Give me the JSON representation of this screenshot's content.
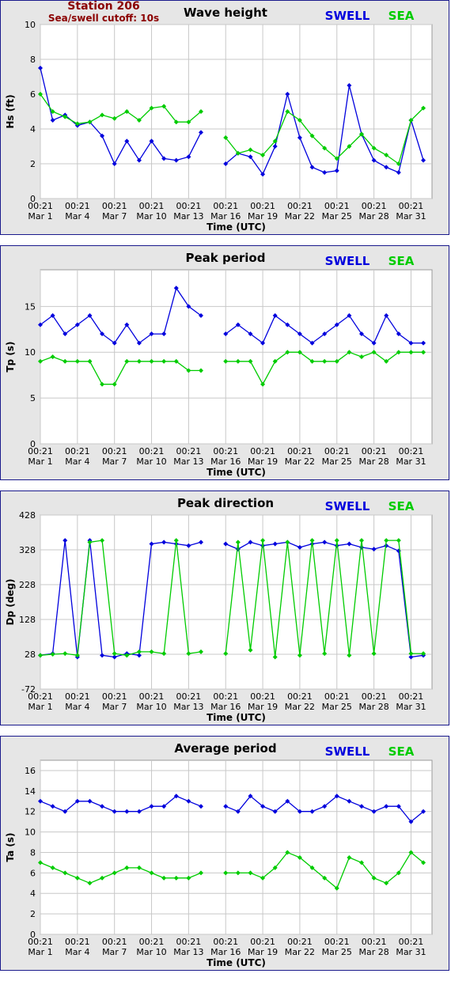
{
  "header": {
    "station_name": "Station 206",
    "cutoff_label": "Sea/swell cutoff: 10s"
  },
  "colors": {
    "swell": "#0000dd",
    "sea": "#00cc00",
    "frame": "#1a1a8c",
    "station_text": "#8b0000"
  },
  "chart_data": [
    {
      "type": "line",
      "title": "Wave height",
      "xlabel": "Time (UTC)",
      "ylabel": "Hs (ft)",
      "ylim": [
        0,
        10
      ],
      "yticks": [
        "0",
        "2",
        "4",
        "6",
        "8",
        "10"
      ],
      "x": [
        1,
        2,
        3,
        4,
        5,
        6,
        7,
        8,
        9,
        10,
        11,
        12,
        13,
        14,
        15,
        16,
        17,
        18,
        19,
        20,
        21,
        22,
        23,
        24,
        25,
        26,
        27,
        28,
        29,
        30,
        31,
        32
      ],
      "x_tick_time": "00:21",
      "x_tick_dates": [
        "Mar 1",
        "Mar 4",
        "Mar 7",
        "Mar 10",
        "Mar 13",
        "Mar 16",
        "Mar 19",
        "Mar 22",
        "Mar 25",
        "Mar 28",
        "Mar 31"
      ],
      "x_tick_positions": [
        1,
        4,
        7,
        10,
        13,
        16,
        19,
        22,
        25,
        28,
        31
      ],
      "xlim": [
        1,
        32.7
      ],
      "grid": true,
      "legend": "top-right",
      "series": [
        {
          "name": "SWELL",
          "values": [
            7.5,
            4.5,
            4.8,
            4.2,
            4.4,
            3.6,
            2.0,
            3.3,
            2.2,
            3.3,
            2.3,
            2.2,
            2.4,
            3.8,
            null,
            2.0,
            2.6,
            2.4,
            1.4,
            3.0,
            6.0,
            3.5,
            1.8,
            1.5,
            1.6,
            6.5,
            3.7,
            2.2,
            1.8,
            1.5,
            4.5,
            2.2
          ]
        },
        {
          "name": "SEA",
          "values": [
            6.0,
            5.0,
            4.7,
            4.3,
            4.4,
            4.8,
            4.6,
            5.0,
            4.5,
            5.2,
            5.3,
            4.4,
            4.4,
            5.0,
            null,
            3.5,
            2.6,
            2.8,
            2.5,
            3.3,
            5.0,
            4.5,
            3.6,
            2.9,
            2.3,
            3.0,
            3.7,
            2.9,
            2.5,
            2.0,
            4.5,
            5.2
          ]
        }
      ]
    },
    {
      "type": "line",
      "title": "Peak period",
      "xlabel": "Time (UTC)",
      "ylabel": "Tp (s)",
      "ylim": [
        0,
        19
      ],
      "yticks": [
        "0",
        "5",
        "10",
        "15"
      ],
      "x": [
        1,
        2,
        3,
        4,
        5,
        6,
        7,
        8,
        9,
        10,
        11,
        12,
        13,
        14,
        15,
        16,
        17,
        18,
        19,
        20,
        21,
        22,
        23,
        24,
        25,
        26,
        27,
        28,
        29,
        30,
        31,
        32
      ],
      "x_tick_time": "00:21",
      "x_tick_dates": [
        "Mar 1",
        "Mar 4",
        "Mar 7",
        "Mar 10",
        "Mar 13",
        "Mar 16",
        "Mar 19",
        "Mar 22",
        "Mar 25",
        "Mar 28",
        "Mar 31"
      ],
      "x_tick_positions": [
        1,
        4,
        7,
        10,
        13,
        16,
        19,
        22,
        25,
        28,
        31
      ],
      "xlim": [
        1,
        32.7
      ],
      "grid": true,
      "legend": "top-right",
      "series": [
        {
          "name": "SWELL",
          "values": [
            13,
            14,
            12,
            13,
            14,
            12,
            11,
            13,
            11,
            12,
            12,
            17,
            15,
            14,
            null,
            12,
            13,
            12,
            11,
            14,
            13,
            12,
            11,
            12,
            13,
            14,
            12,
            11,
            14,
            12,
            11,
            11
          ]
        },
        {
          "name": "SEA",
          "values": [
            9,
            9.5,
            9,
            9,
            9,
            6.5,
            6.5,
            9,
            9,
            9,
            9,
            9,
            8,
            8,
            null,
            9,
            9,
            9,
            6.5,
            9,
            10,
            10,
            9,
            9,
            9,
            10,
            9.5,
            10,
            9,
            10,
            10,
            10
          ]
        }
      ]
    },
    {
      "type": "scatter",
      "title": "Peak direction",
      "xlabel": "Time (UTC)",
      "ylabel": "Dp (deg)",
      "ylim": [
        -72,
        428
      ],
      "yticks": [
        "-72",
        "28",
        "128",
        "228",
        "328",
        "428"
      ],
      "x": [
        1,
        2,
        3,
        4,
        5,
        6,
        7,
        8,
        9,
        10,
        11,
        12,
        13,
        14,
        15,
        16,
        17,
        18,
        19,
        20,
        21,
        22,
        23,
        24,
        25,
        26,
        27,
        28,
        29,
        30,
        31,
        32
      ],
      "x_tick_time": "00:21",
      "x_tick_dates": [
        "Mar 1",
        "Mar 4",
        "Mar 7",
        "Mar 10",
        "Mar 13",
        "Mar 16",
        "Mar 19",
        "Mar 22",
        "Mar 25",
        "Mar 28",
        "Mar 31"
      ],
      "x_tick_positions": [
        1,
        4,
        7,
        10,
        13,
        16,
        19,
        22,
        25,
        28,
        31
      ],
      "xlim": [
        1,
        32.7
      ],
      "grid": true,
      "legend": "top-right",
      "series": [
        {
          "name": "SWELL",
          "values": [
            25,
            30,
            355,
            20,
            355,
            25,
            20,
            30,
            25,
            345,
            350,
            345,
            340,
            350,
            null,
            345,
            330,
            350,
            340,
            345,
            350,
            335,
            345,
            350,
            340,
            345,
            335,
            330,
            340,
            325,
            20,
            25
          ]
        },
        {
          "name": "SEA",
          "values": [
            25,
            28,
            30,
            25,
            350,
            355,
            30,
            25,
            35,
            35,
            30,
            355,
            30,
            35,
            null,
            30,
            350,
            40,
            355,
            20,
            350,
            25,
            355,
            30,
            355,
            25,
            355,
            30,
            355,
            355,
            30,
            30
          ]
        }
      ]
    },
    {
      "type": "line",
      "title": "Average period",
      "xlabel": "Time (UTC)",
      "ylabel": "Ta (s)",
      "ylim": [
        0,
        17
      ],
      "yticks": [
        "0",
        "2",
        "4",
        "6",
        "8",
        "10",
        "12",
        "14",
        "16"
      ],
      "x": [
        1,
        2,
        3,
        4,
        5,
        6,
        7,
        8,
        9,
        10,
        11,
        12,
        13,
        14,
        15,
        16,
        17,
        18,
        19,
        20,
        21,
        22,
        23,
        24,
        25,
        26,
        27,
        28,
        29,
        30,
        31,
        32
      ],
      "x_tick_time": "00:21",
      "x_tick_dates": [
        "Mar 1",
        "Mar 4",
        "Mar 7",
        "Mar 10",
        "Mar 13",
        "Mar 16",
        "Mar 19",
        "Mar 22",
        "Mar 25",
        "Mar 28",
        "Mar 31"
      ],
      "x_tick_positions": [
        1,
        4,
        7,
        10,
        13,
        16,
        19,
        22,
        25,
        28,
        31
      ],
      "xlim": [
        1,
        32.7
      ],
      "grid": true,
      "legend": "top-right",
      "series": [
        {
          "name": "SWELL",
          "values": [
            13,
            12.5,
            12,
            13,
            13,
            12.5,
            12,
            12,
            12,
            12.5,
            12.5,
            13.5,
            13,
            12.5,
            null,
            12.5,
            12,
            13.5,
            12.5,
            12,
            13,
            12,
            12,
            12.5,
            13.5,
            13,
            12.5,
            12,
            12.5,
            12.5,
            11,
            12
          ]
        },
        {
          "name": "SEA",
          "values": [
            7,
            6.5,
            6,
            5.5,
            5,
            5.5,
            6,
            6.5,
            6.5,
            6,
            5.5,
            5.5,
            5.5,
            6,
            null,
            6,
            6,
            6,
            5.5,
            6.5,
            8,
            7.5,
            6.5,
            5.5,
            4.5,
            7.5,
            7,
            5.5,
            5,
            6,
            8,
            7
          ]
        }
      ]
    }
  ]
}
